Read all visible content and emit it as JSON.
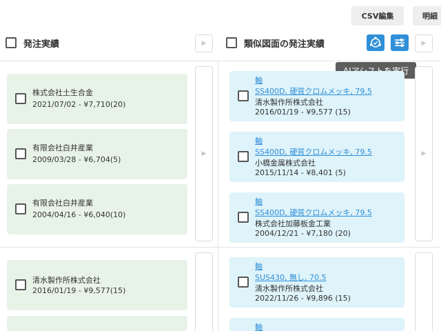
{
  "toolbar": {
    "csv_label": "CSV編集",
    "detail_label": "明細"
  },
  "left_header": {
    "title": "発注実績"
  },
  "right_header": {
    "title": "類似図面の発注実績"
  },
  "tooltip": "AIアシストを実行",
  "icons": {
    "nav": "chevron-right-icon",
    "ai": "ai-assist-icon",
    "filter": "sliders-icon"
  },
  "colors": {
    "accent": "#2f8fd8",
    "green_card": "#e8f3e8",
    "blue_card": "#def3fa"
  },
  "groups": [
    {
      "left": [
        {
          "company": "株式会社土生合金",
          "info": "2021/07/02 - ¥7,710(20)"
        },
        {
          "company": "有限会社白井産業",
          "info": "2009/03/28 - ¥6,704(5)"
        },
        {
          "company": "有限会社白井産業",
          "info": "2004/04/16 - ¥6,040(10)"
        }
      ],
      "right": [
        {
          "category": "軸",
          "spec": "SS400D, 硬質クロムメッキ, 79.5",
          "company": "清水製作所株式会社",
          "info": "2016/01/19 - ¥9,577 (15)"
        },
        {
          "category": "軸",
          "spec": "SS400D, 硬質クロムメッキ, 79.5",
          "company": "小橋金属株式会社",
          "info": "2015/11/14 - ¥8,401 (5)"
        },
        {
          "category": "軸",
          "spec": "SS400D, 硬質クロムメッキ, 79.5",
          "company": "株式会社加藤板金工業",
          "info": "2004/12/21 - ¥7,180 (20)"
        }
      ]
    },
    {
      "left": [
        {
          "company": "清水製作所株式会社",
          "info": "2016/01/19 - ¥9,577(15)"
        }
      ],
      "right": [
        {
          "category": "軸",
          "spec": "SUS430, 無し, 70.5",
          "company": "清水製作所株式会社",
          "info": "2022/11/26 - ¥9,896 (15)"
        },
        {
          "category": "軸"
        }
      ]
    }
  ]
}
